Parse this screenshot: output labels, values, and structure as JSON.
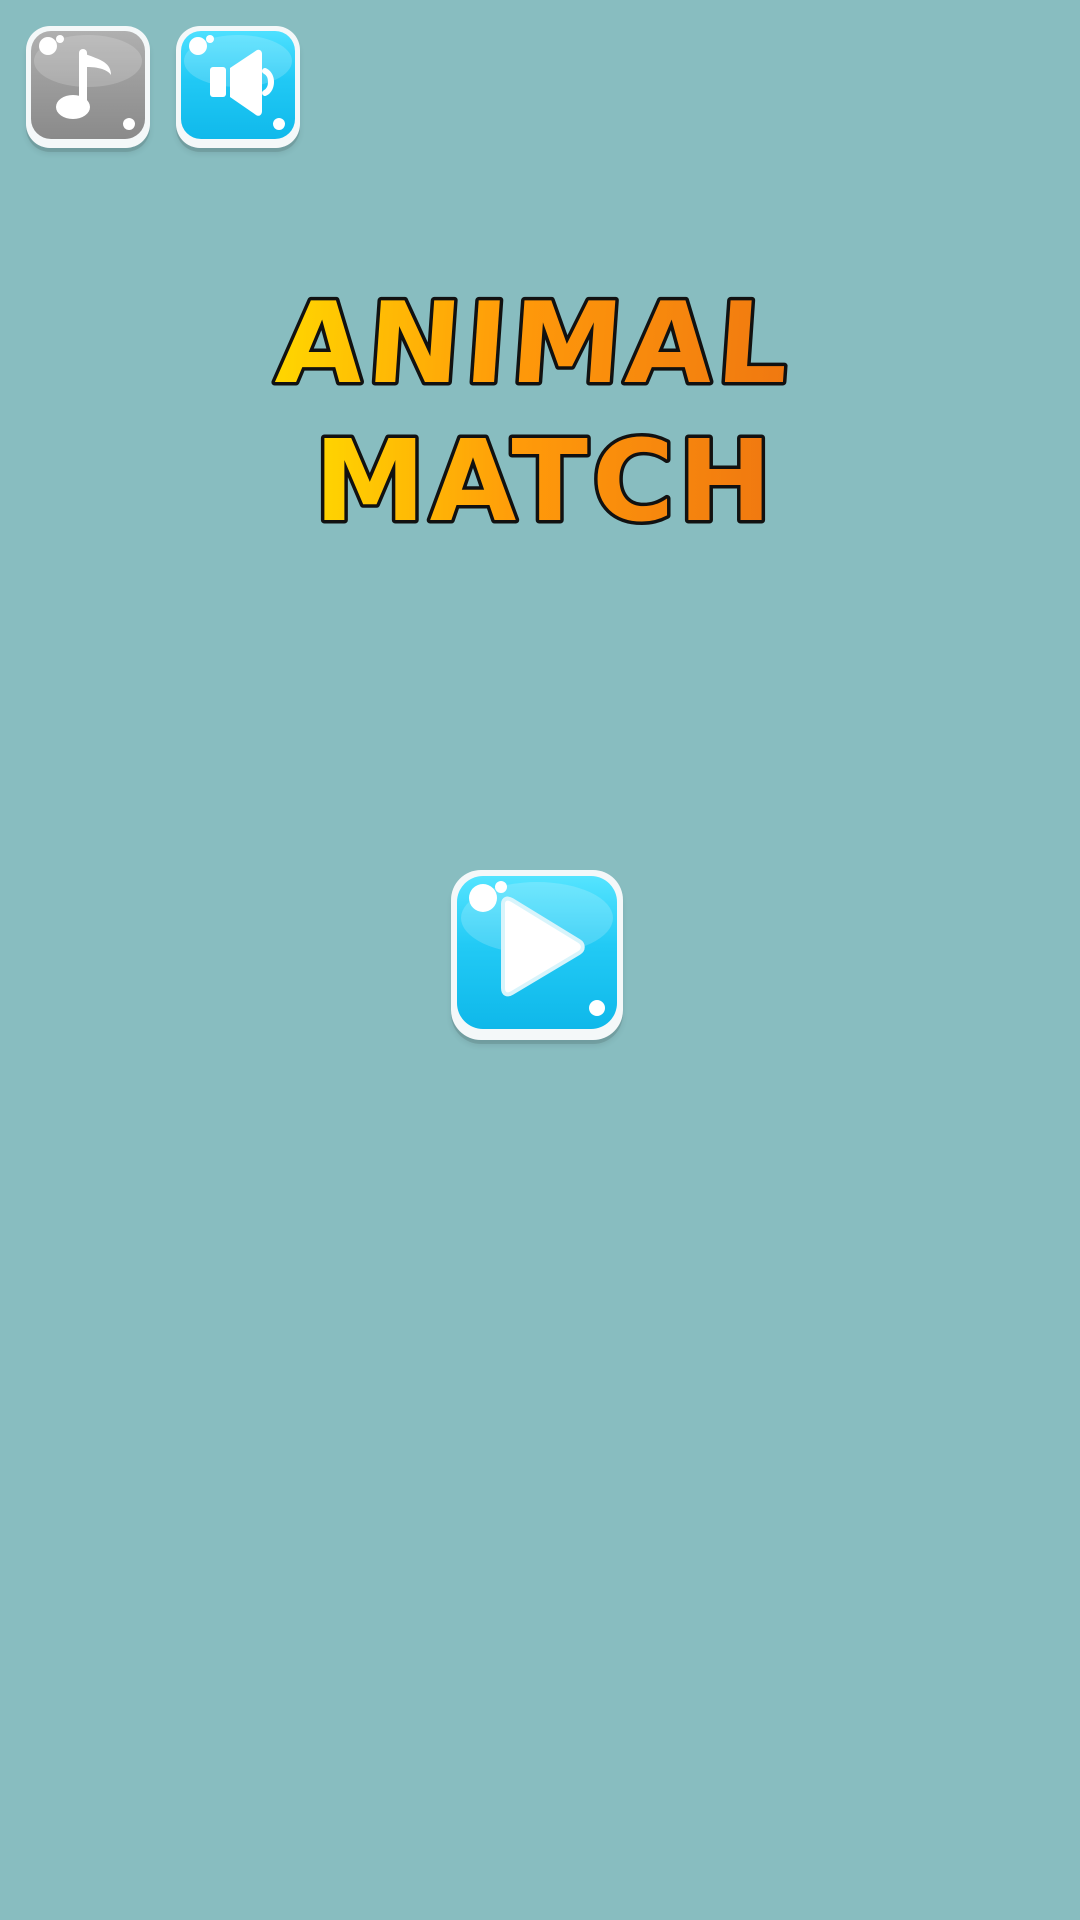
{
  "title": {
    "line1": "ANIMAL",
    "line2": "MATCH",
    "gradient_start": "#ffd600",
    "gradient_mid": "#ff9a0a",
    "gradient_end": "#f07810",
    "outline": "#111111"
  },
  "toolbar": {
    "music_button": {
      "icon": "music-note-icon",
      "state": "off",
      "color": "#9d9d9d"
    },
    "sound_button": {
      "icon": "speaker-icon",
      "state": "on",
      "color": "#21c9f5"
    }
  },
  "play_button": {
    "icon": "play-icon",
    "color": "#21c9f5"
  },
  "background": "#88bdc0"
}
